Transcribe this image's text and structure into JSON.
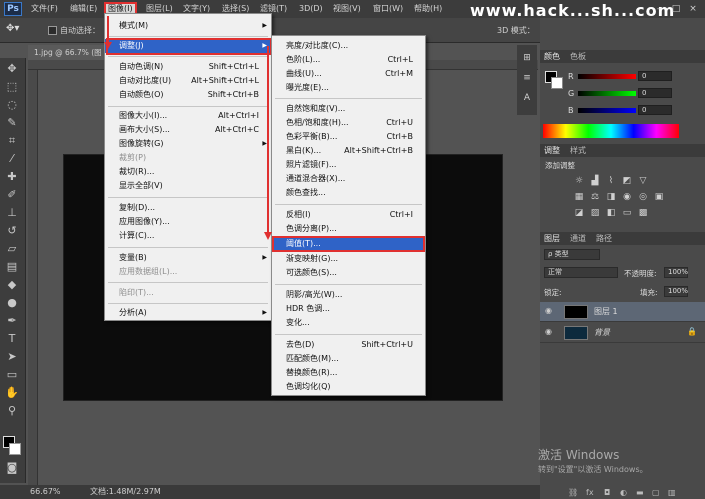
{
  "app": {
    "logo": "Ps"
  },
  "menubar": {
    "items": [
      "文件(F)",
      "编辑(E)",
      "图像(I)",
      "图层(L)",
      "文字(Y)",
      "选择(S)",
      "滤镜(T)",
      "3D(D)",
      "视图(V)",
      "窗口(W)",
      "帮助(H)"
    ],
    "window_controls": [
      "–",
      "□",
      "×"
    ]
  },
  "watermark": "www.hack...sh...com",
  "options": {
    "auto_select_label": "自动选择：",
    "mode_label": "3D 模式："
  },
  "document": {
    "tab_title": "1.jpg @ 66.7% (图"
  },
  "status": {
    "zoom": "66.67%",
    "doc_size": "文档:1.48M/2.97M"
  },
  "image_menu": {
    "items": [
      {
        "label": "模式(M)",
        "shortcut": "",
        "submenu": true,
        "disabled": false
      },
      {
        "label": "调整(J)",
        "shortcut": "",
        "submenu": true,
        "disabled": false
      },
      {
        "label": "自动色调(N)",
        "shortcut": "Shift+Ctrl+L",
        "submenu": false,
        "disabled": false
      },
      {
        "label": "自动对比度(U)",
        "shortcut": "Alt+Shift+Ctrl+L",
        "submenu": false,
        "disabled": false
      },
      {
        "label": "自动颜色(O)",
        "shortcut": "Shift+Ctrl+B",
        "submenu": false,
        "disabled": false
      },
      {
        "label": "图像大小(I)...",
        "shortcut": "Alt+Ctrl+I",
        "submenu": false,
        "disabled": false
      },
      {
        "label": "画布大小(S)...",
        "shortcut": "Alt+Ctrl+C",
        "submenu": false,
        "disabled": false
      },
      {
        "label": "图像旋转(G)",
        "shortcut": "",
        "submenu": true,
        "disabled": false
      },
      {
        "label": "裁剪(P)",
        "shortcut": "",
        "submenu": false,
        "disabled": true
      },
      {
        "label": "裁切(R)...",
        "shortcut": "",
        "submenu": false,
        "disabled": false
      },
      {
        "label": "显示全部(V)",
        "shortcut": "",
        "submenu": false,
        "disabled": false
      },
      {
        "label": "复制(D)...",
        "shortcut": "",
        "submenu": false,
        "disabled": false
      },
      {
        "label": "应用图像(Y)...",
        "shortcut": "",
        "submenu": false,
        "disabled": false
      },
      {
        "label": "计算(C)...",
        "shortcut": "",
        "submenu": false,
        "disabled": false
      },
      {
        "label": "变量(B)",
        "shortcut": "",
        "submenu": true,
        "disabled": false
      },
      {
        "label": "应用数据组(L)...",
        "shortcut": "",
        "submenu": false,
        "disabled": true
      },
      {
        "label": "陷印(T)...",
        "shortcut": "",
        "submenu": false,
        "disabled": true
      },
      {
        "label": "分析(A)",
        "shortcut": "",
        "submenu": true,
        "disabled": false
      }
    ]
  },
  "adjust_menu": {
    "items": [
      {
        "label": "亮度/对比度(C)...",
        "shortcut": ""
      },
      {
        "label": "色阶(L)...",
        "shortcut": "Ctrl+L"
      },
      {
        "label": "曲线(U)...",
        "shortcut": "Ctrl+M"
      },
      {
        "label": "曝光度(E)...",
        "shortcut": ""
      },
      {
        "label": "自然饱和度(V)...",
        "shortcut": ""
      },
      {
        "label": "色相/饱和度(H)...",
        "shortcut": "Ctrl+U"
      },
      {
        "label": "色彩平衡(B)...",
        "shortcut": "Ctrl+B"
      },
      {
        "label": "黑白(K)...",
        "shortcut": "Alt+Shift+Ctrl+B"
      },
      {
        "label": "照片滤镜(F)...",
        "shortcut": ""
      },
      {
        "label": "通道混合器(X)...",
        "shortcut": ""
      },
      {
        "label": "颜色查找...",
        "shortcut": ""
      },
      {
        "label": "反相(I)",
        "shortcut": "Ctrl+I"
      },
      {
        "label": "色调分离(P)...",
        "shortcut": ""
      },
      {
        "label": "阈值(T)...",
        "shortcut": ""
      },
      {
        "label": "渐变映射(G)...",
        "shortcut": ""
      },
      {
        "label": "可选颜色(S)...",
        "shortcut": ""
      },
      {
        "label": "阴影/高光(W)...",
        "shortcut": ""
      },
      {
        "label": "HDR 色调...",
        "shortcut": ""
      },
      {
        "label": "变化...",
        "shortcut": ""
      },
      {
        "label": "去色(D)",
        "shortcut": "Shift+Ctrl+U"
      },
      {
        "label": "匹配颜色(M)...",
        "shortcut": ""
      },
      {
        "label": "替换颜色(R)...",
        "shortcut": ""
      },
      {
        "label": "色调均化(Q)",
        "shortcut": ""
      }
    ]
  },
  "color_panel": {
    "tabs": [
      "颜色",
      "色板"
    ],
    "channels": [
      {
        "label": "R",
        "value": "0"
      },
      {
        "label": "G",
        "value": "0"
      },
      {
        "label": "B",
        "value": "0"
      }
    ]
  },
  "adjustments_panel": {
    "tabs": [
      "调整",
      "样式"
    ],
    "title": "添加调整"
  },
  "layers_panel": {
    "tabs": [
      "图层",
      "通道",
      "路径"
    ],
    "kind_filter": "ρ 类型",
    "blend_mode": "正常",
    "opacity_label": "不透明度:",
    "opacity_value": "100%",
    "lock_label": "锁定:",
    "fill_label": "填充:",
    "fill_value": "100%",
    "layers": [
      {
        "name": "图层 1",
        "selected": true,
        "locked": false
      },
      {
        "name": "背景",
        "selected": false,
        "locked": true
      }
    ]
  },
  "activation": {
    "line1": "激活 Windows",
    "line2": "转到\"设置\"以激活 Windows。"
  },
  "colors": {
    "highlight": "#2f63c7",
    "annotation_red": "#e03030"
  }
}
